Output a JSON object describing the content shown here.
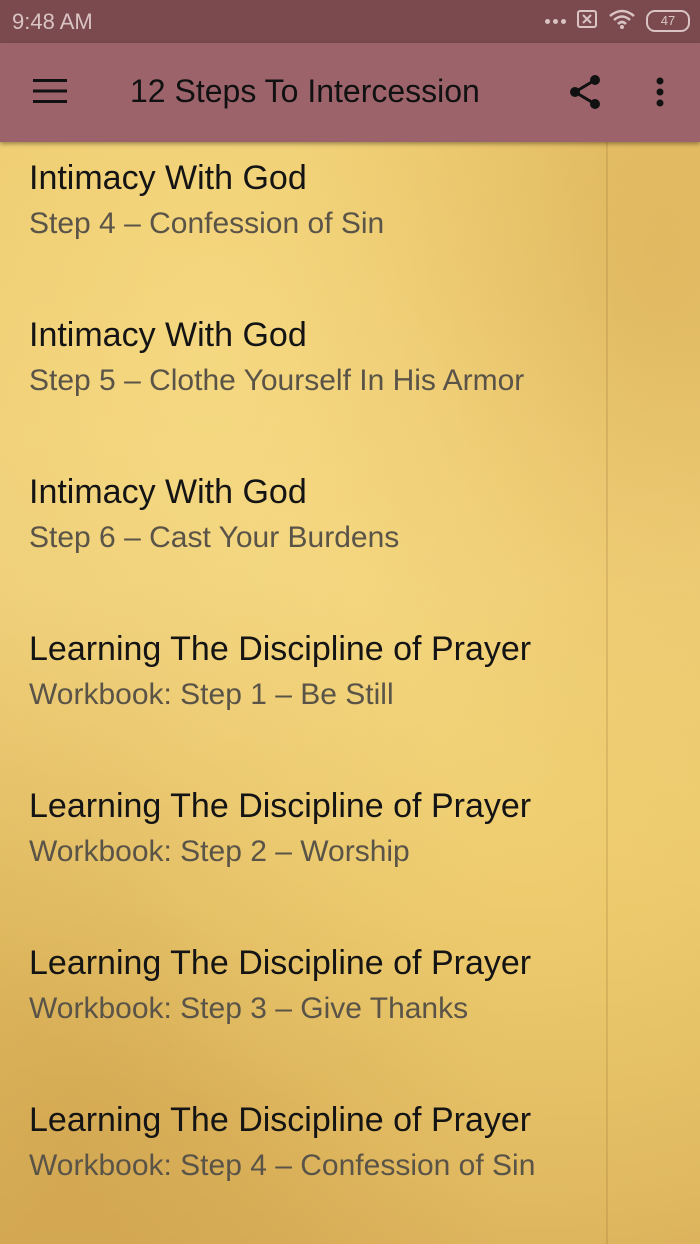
{
  "status_bar": {
    "time": "9:48 AM",
    "battery": "47",
    "icons": [
      "dots-icon",
      "sim-off-icon",
      "wifi-icon",
      "battery-icon"
    ]
  },
  "app_bar": {
    "title": "12 Steps To Intercession",
    "icons": [
      "menu-icon",
      "share-icon",
      "more-vert-icon"
    ]
  },
  "colors": {
    "status_bar": "#7a4a4f",
    "app_bar": "#9c636b",
    "background": "#e9c96e"
  },
  "items": [
    {
      "title": "Intimacy With God",
      "subtitle": "Step 4 – Confession of Sin"
    },
    {
      "title": "Intimacy With God",
      "subtitle": "Step 5 – Clothe Yourself In His Armor"
    },
    {
      "title": "Intimacy With God",
      "subtitle": "Step 6 – Cast Your Burdens"
    },
    {
      "title": "Learning The Discipline of Prayer",
      "subtitle": "Workbook: Step 1 – Be Still"
    },
    {
      "title": "Learning The Discipline of Prayer",
      "subtitle": "Workbook: Step 2 – Worship"
    },
    {
      "title": "Learning The Discipline of Prayer",
      "subtitle": "Workbook: Step 3 – Give Thanks"
    },
    {
      "title": "Learning The Discipline of Prayer",
      "subtitle": "Workbook: Step 4 – Confession of Sin"
    }
  ]
}
